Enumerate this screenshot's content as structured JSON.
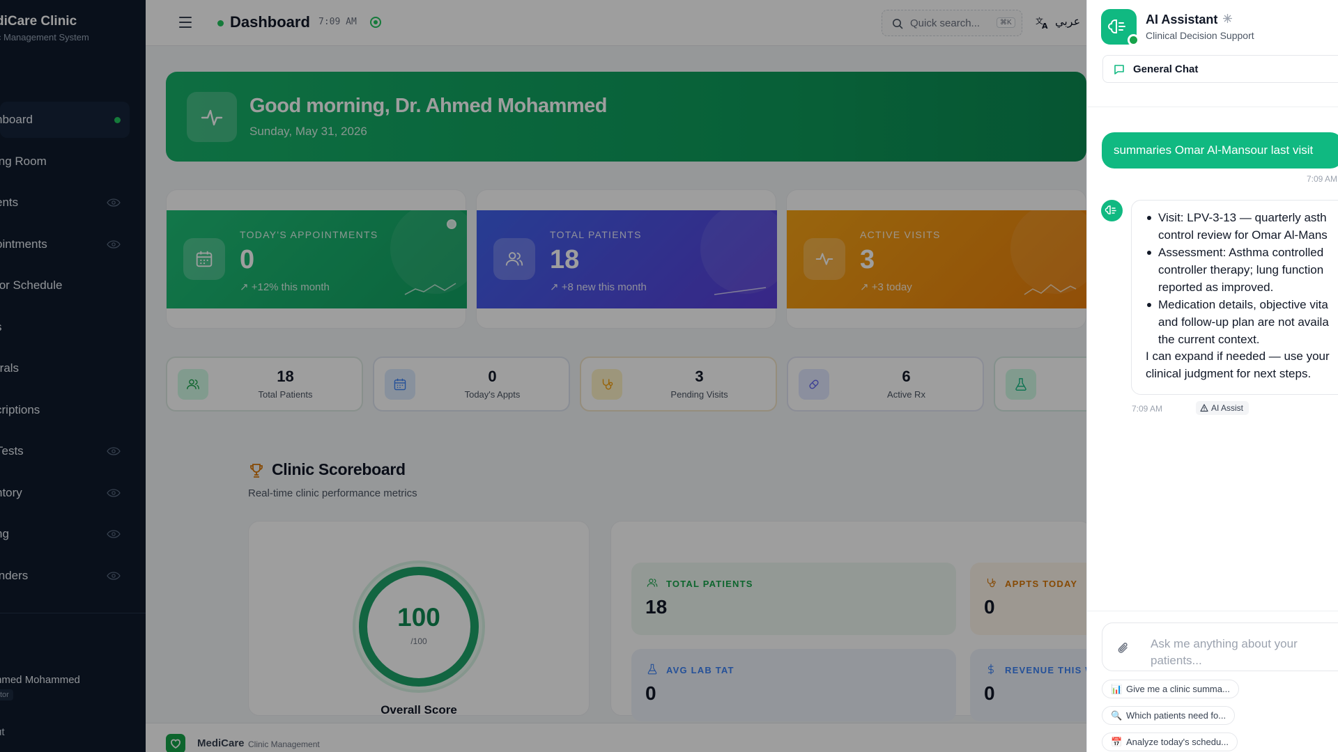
{
  "brand": {
    "name": "diCare Clinic",
    "subtitle": "ic Management System"
  },
  "sidebar": {
    "items": [
      {
        "label": "hboard",
        "active": true,
        "icon": "active-dot"
      },
      {
        "label": "ing Room",
        "icon": ""
      },
      {
        "label": "ents",
        "icon": "eye-icon"
      },
      {
        "label": "ointments",
        "icon": "eye-icon"
      },
      {
        "label": "tor Schedule",
        "icon": ""
      },
      {
        "label": "s",
        "icon": ""
      },
      {
        "label": "rrals",
        "icon": ""
      },
      {
        "label": "criptions",
        "icon": ""
      },
      {
        "label": "Tests",
        "icon": "eye-icon"
      },
      {
        "label": "ntory",
        "icon": "eye-icon"
      },
      {
        "label": "ng",
        "icon": "eye-icon"
      },
      {
        "label": "inders",
        "icon": "eye-icon"
      }
    ],
    "user_name": "hmed Mohammed",
    "user_role": "tor",
    "logout": "ut"
  },
  "topbar": {
    "title": "Dashboard",
    "time": "7:09 AM",
    "search_placeholder": "Quick search...",
    "search_shortcut": "⌘K",
    "language": "عربي"
  },
  "hero": {
    "greeting": "Good morning, Dr. Ahmed Mohammed",
    "date": "Sunday, May 31, 2026"
  },
  "stat_cards": [
    {
      "label": "TODAY'S APPOINTMENTS",
      "value": "0",
      "trend": "↗ +12% this month",
      "color": "#17b26a",
      "icon": "calendar-icon"
    },
    {
      "label": "TOTAL PATIENTS",
      "value": "18",
      "trend": "↗ +8 new this month",
      "color": "#3b5bdb",
      "icon": "users-icon"
    },
    {
      "label": "ACTIVE VISITS",
      "value": "3",
      "trend": "↗ +3 today",
      "color": "#f59e0b",
      "icon": "activity-icon"
    }
  ],
  "mini_stats": [
    {
      "value": "18",
      "label": "Total Patients",
      "icon": "users-icon",
      "color": "#16a34a"
    },
    {
      "value": "0",
      "label": "Today's Appts",
      "icon": "calendar-icon",
      "color": "#3b82f6"
    },
    {
      "value": "3",
      "label": "Pending Visits",
      "icon": "stethoscope-icon",
      "color": "#f59e0b"
    },
    {
      "value": "6",
      "label": "Active Rx",
      "icon": "pill-icon",
      "color": "#6366f1"
    },
    {
      "value": "",
      "label": "",
      "icon": "flask-icon",
      "color": "#10b981"
    }
  ],
  "scoreboard": {
    "title": "Clinic Scoreboard",
    "subtitle": "Real-time clinic performance metrics",
    "score": "100",
    "score_max": "/100",
    "score_fraction": 1.0,
    "score_label": "Overall Score",
    "metrics": [
      {
        "label": "TOTAL PATIENTS",
        "value": "18",
        "color": "#16a34a",
        "icon": "users-icon"
      },
      {
        "label": "APPTS TODAY",
        "value": "0",
        "color": "#d97706",
        "icon": "stethoscope-icon"
      },
      {
        "label": "AVG LAB TAT",
        "value": "0",
        "color": "#3b82f6",
        "icon": "flask-icon"
      },
      {
        "label": "REVENUE THIS W",
        "value": "0",
        "color": "#3b82f6",
        "icon": "dollar-icon"
      }
    ]
  },
  "footer": {
    "name": "MediCare",
    "subtitle": "Clinic Management"
  },
  "ai": {
    "title": "AI Assistant",
    "subtitle": "Clinical Decision Support",
    "chat_tab": "General Chat",
    "user_message": "summaries Omar Al-Mansour last visit",
    "user_time": "7:09 AM",
    "bot_lines": [
      [
        "Visit: LPV-3-13 — quarterly asth",
        "control review for Omar Al-Mans"
      ],
      [
        "Assessment: Asthma controlled",
        "controller therapy; lung function",
        "reported as improved."
      ],
      [
        "Medication details, objective vita",
        "and follow-up plan are not availa",
        "the current context."
      ]
    ],
    "bot_closing": [
      "I can expand if needed — use your",
      "clinical judgment for next steps."
    ],
    "bot_time": "7:09 AM",
    "bot_tag": "AI Assist",
    "input_placeholder": "Ask me anything about your patients...",
    "suggestions": [
      {
        "emoji": "📊",
        "text": "Give me a clinic summa..."
      },
      {
        "emoji": "🔍",
        "text": "Which patients need fo..."
      },
      {
        "emoji": "📅",
        "text": "Analyze today's schedu..."
      }
    ]
  }
}
